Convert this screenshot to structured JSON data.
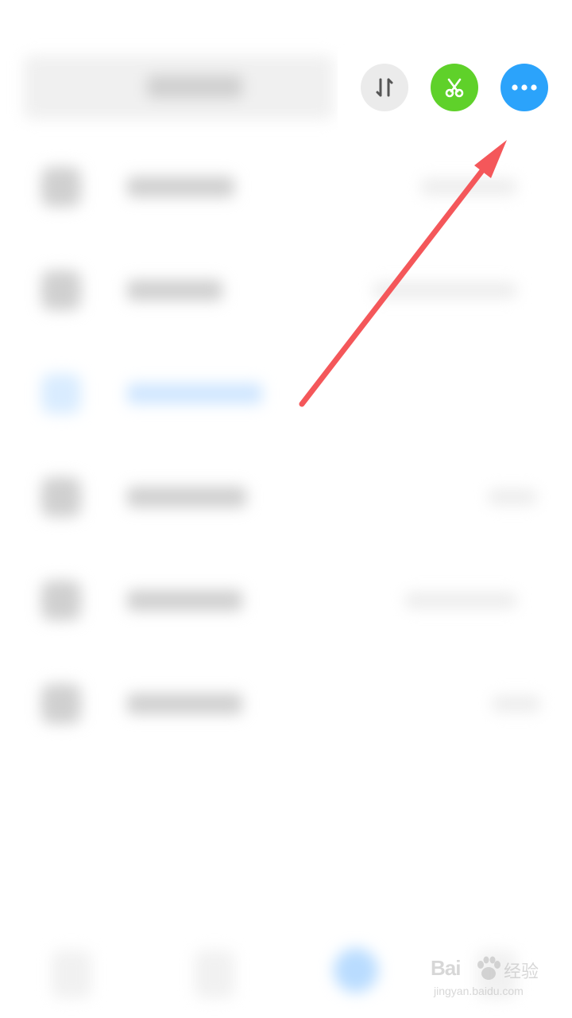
{
  "toolbar": {
    "buttons": [
      {
        "id": "sort",
        "icon": "sort-arrows-icon",
        "color": "#ebebeb"
      },
      {
        "id": "cut",
        "icon": "scissors-icon",
        "color": "#5fd12a"
      },
      {
        "id": "more",
        "icon": "more-dots-icon",
        "color": "#2ba3fb"
      }
    ]
  },
  "annotation": {
    "icon": "red-arrow-icon",
    "color": "#f4575a"
  },
  "watermark": {
    "brand": "Bai",
    "suffix": "经验",
    "url": "jingyan.baidu.com"
  },
  "colors": {
    "accent_blue": "#2ba3fb",
    "accent_green": "#5fd12a",
    "arrow_red": "#f4575a"
  }
}
